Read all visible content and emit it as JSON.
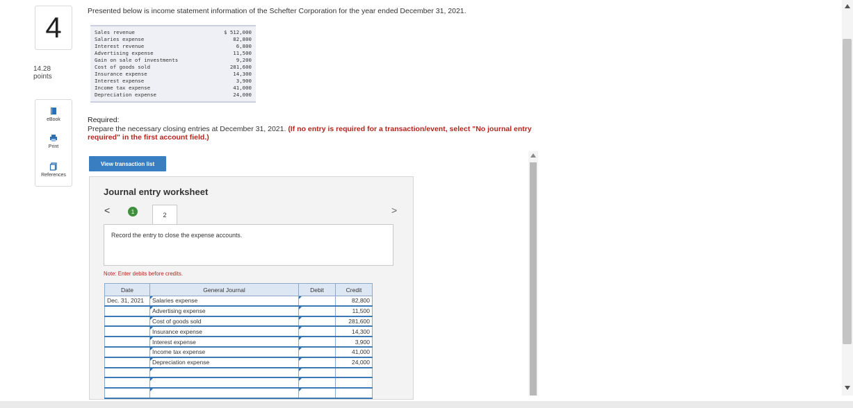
{
  "question": {
    "number": "4",
    "points": "14.28",
    "points_label": "points"
  },
  "tools": [
    {
      "label": "eBook",
      "icon": "book-icon"
    },
    {
      "label": "Print",
      "icon": "print-icon"
    },
    {
      "label": "References",
      "icon": "references-icon"
    }
  ],
  "intro": "Presented below is income statement information of the Schefter Corporation for the year ended December 31, 2021.",
  "income_items": [
    {
      "label": "Sales revenue",
      "value": "$ 512,000"
    },
    {
      "label": "Salaries expense",
      "value": "82,800"
    },
    {
      "label": "Interest revenue",
      "value": "6,800"
    },
    {
      "label": "Advertising expense",
      "value": "11,500"
    },
    {
      "label": "Gain on sale of investments",
      "value": "9,200"
    },
    {
      "label": "Cost of goods sold",
      "value": "281,600"
    },
    {
      "label": "Insurance expense",
      "value": "14,300"
    },
    {
      "label": "Interest expense",
      "value": "3,900"
    },
    {
      "label": "Income tax expense",
      "value": "41,000"
    },
    {
      "label": "Depreciation expense",
      "value": "24,000"
    }
  ],
  "required": {
    "heading": "Required:",
    "text": "Prepare the necessary closing entries at December 31, 2021. ",
    "emphasis": "(If no entry is required for a transaction/event, select \"No journal entry required\" in the first account field.)"
  },
  "view_button": "View transaction list",
  "worksheet": {
    "title": "Journal entry worksheet",
    "prev": "<",
    "next": ">",
    "steps": [
      "1",
      "2"
    ],
    "description": "Record the entry to close the expense accounts.",
    "note": "Note: Enter debits before credits.",
    "columns": [
      "Date",
      "General Journal",
      "Debit",
      "Credit"
    ],
    "rows": [
      {
        "date": "Dec. 31, 2021",
        "account": "Salaries expense",
        "debit": "",
        "credit": "82,800"
      },
      {
        "date": "",
        "account": "Advertising expense",
        "debit": "",
        "credit": "11,500"
      },
      {
        "date": "",
        "account": "Cost of goods sold",
        "debit": "",
        "credit": "281,600"
      },
      {
        "date": "",
        "account": "Insurance expense",
        "debit": "",
        "credit": "14,300"
      },
      {
        "date": "",
        "account": "Interest expense",
        "debit": "",
        "credit": "3,900"
      },
      {
        "date": "",
        "account": "Income tax expense",
        "debit": "",
        "credit": "41,000"
      },
      {
        "date": "",
        "account": "Depreciation expense",
        "debit": "",
        "credit": "24,000"
      },
      {
        "date": "",
        "account": "",
        "debit": "",
        "credit": ""
      },
      {
        "date": "",
        "account": "",
        "debit": "",
        "credit": ""
      },
      {
        "date": "",
        "account": "",
        "debit": "",
        "credit": ""
      }
    ]
  },
  "colors": {
    "accent": "#3a7ec2",
    "warning": "#b3261e",
    "step_done": "#3f8f3f"
  }
}
